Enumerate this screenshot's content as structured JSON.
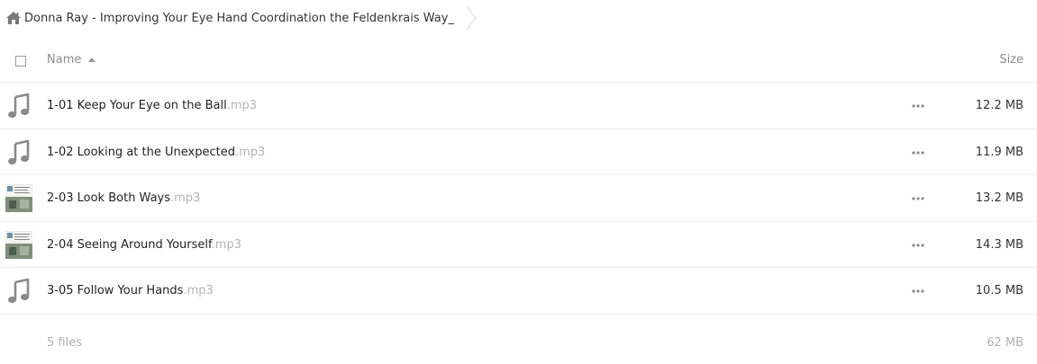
{
  "breadcrumb": {
    "path": "Donna Ray - Improving Your Eye Hand Coordination the Feldenkrais Way_"
  },
  "header": {
    "name_label": "Name",
    "size_label": "Size"
  },
  "files": [
    {
      "name": "1-01 Keep Your Eye on the Ball",
      "ext": ".mp3",
      "size": "12.2 MB",
      "icon": "music-icon"
    },
    {
      "name": "1-02 Looking at the Unexpected",
      "ext": ".mp3",
      "size": "11.9 MB",
      "icon": "music-icon"
    },
    {
      "name": "2-03 Look Both Ways",
      "ext": ".mp3",
      "size": "13.2 MB",
      "icon": "album-art-thumbnail"
    },
    {
      "name": "2-04 Seeing Around Yourself",
      "ext": ".mp3",
      "size": "14.3 MB",
      "icon": "album-art-thumbnail"
    },
    {
      "name": "3-05 Follow Your Hands",
      "ext": ".mp3",
      "size": "10.5 MB",
      "icon": "music-icon"
    }
  ],
  "footer": {
    "count": "5 files",
    "total": "62 MB"
  },
  "colors": {
    "icon_gray": "#8a8a8a",
    "divider": "#ececec",
    "muted_text": "#b0b0b0"
  }
}
